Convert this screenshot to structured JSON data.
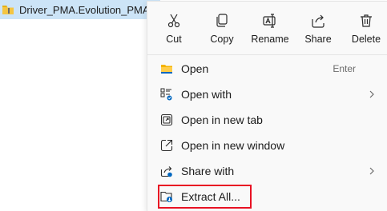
{
  "file": {
    "name": "Driver_PMA.Evolution_PMA.HD"
  },
  "actions": [
    {
      "label": "Cut",
      "icon": "scissors-icon"
    },
    {
      "label": "Copy",
      "icon": "copy-icon"
    },
    {
      "label": "Rename",
      "icon": "rename-icon"
    },
    {
      "label": "Share",
      "icon": "share-icon"
    },
    {
      "label": "Delete",
      "icon": "trash-icon"
    }
  ],
  "items": [
    {
      "label": "Open",
      "shortcut": "Enter",
      "icon": "folder-icon"
    },
    {
      "label": "Open with",
      "icon": "open-with-icon",
      "submenu": true
    },
    {
      "label": "Open in new tab",
      "icon": "new-tab-icon"
    },
    {
      "label": "Open in new window",
      "icon": "new-window-icon"
    },
    {
      "label": "Share with",
      "icon": "share-with-icon",
      "submenu": true
    },
    {
      "label": "Extract All...",
      "icon": "extract-icon",
      "highlighted": true
    }
  ],
  "colors": {
    "accent": "#0067c0",
    "highlight": "#e81123",
    "folder": "#f4b400",
    "selection": "#cce4f7"
  }
}
